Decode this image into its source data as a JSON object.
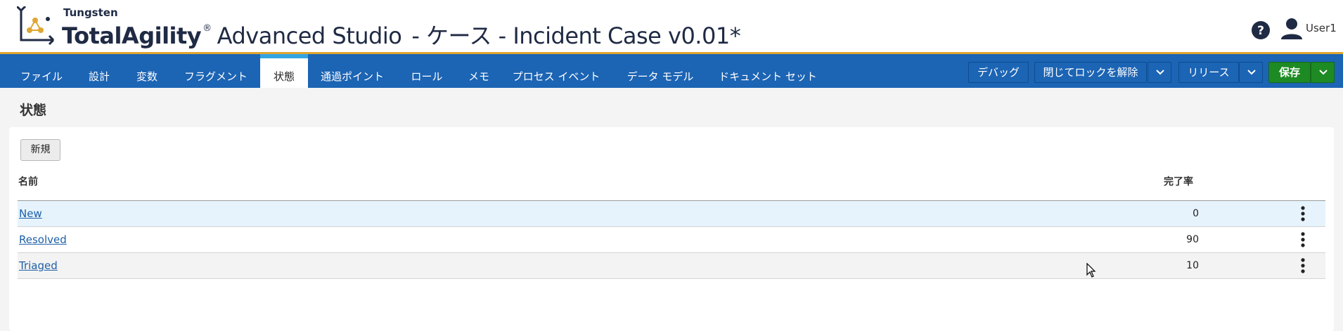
{
  "header": {
    "brand_small": "Tungsten",
    "brand_main": "TotalAgility",
    "brand_reg": "®",
    "brand_product": "Advanced Studio",
    "title_suffix": "- ケース - Incident Case v0.01*",
    "user_name": "User1",
    "icons": [
      "tungsten-logo-icon",
      "help-icon",
      "user-icon"
    ]
  },
  "nav": {
    "tabs": [
      {
        "label": "ファイル",
        "active": false
      },
      {
        "label": "設計",
        "active": false
      },
      {
        "label": "変数",
        "active": false
      },
      {
        "label": "フラグメント",
        "active": false
      },
      {
        "label": "状態",
        "active": true
      },
      {
        "label": "通過ポイント",
        "active": false
      },
      {
        "label": "ロール",
        "active": false
      },
      {
        "label": "メモ",
        "active": false
      },
      {
        "label": "プロセス イベント",
        "active": false
      },
      {
        "label": "データ モデル",
        "active": false
      },
      {
        "label": "ドキュメント セット",
        "active": false
      }
    ],
    "buttons": {
      "debug": "デバッグ",
      "close_unlock": "閉じてロックを解除",
      "release": "リリース",
      "save": "保存"
    }
  },
  "page": {
    "title": "状態",
    "new_button": "新規",
    "columns": {
      "name": "名前",
      "completion": "完了率"
    },
    "rows": [
      {
        "name": "New",
        "completion": "0"
      },
      {
        "name": "Resolved",
        "completion": "90"
      },
      {
        "name": "Triaged",
        "completion": "10"
      }
    ]
  },
  "colors": {
    "nav_blue": "#1c64b4",
    "active_tab_accent": "#34a5e0",
    "save_green": "#1e8a23",
    "header_accent": "#e0a632",
    "link_blue": "#1d5fa8"
  }
}
